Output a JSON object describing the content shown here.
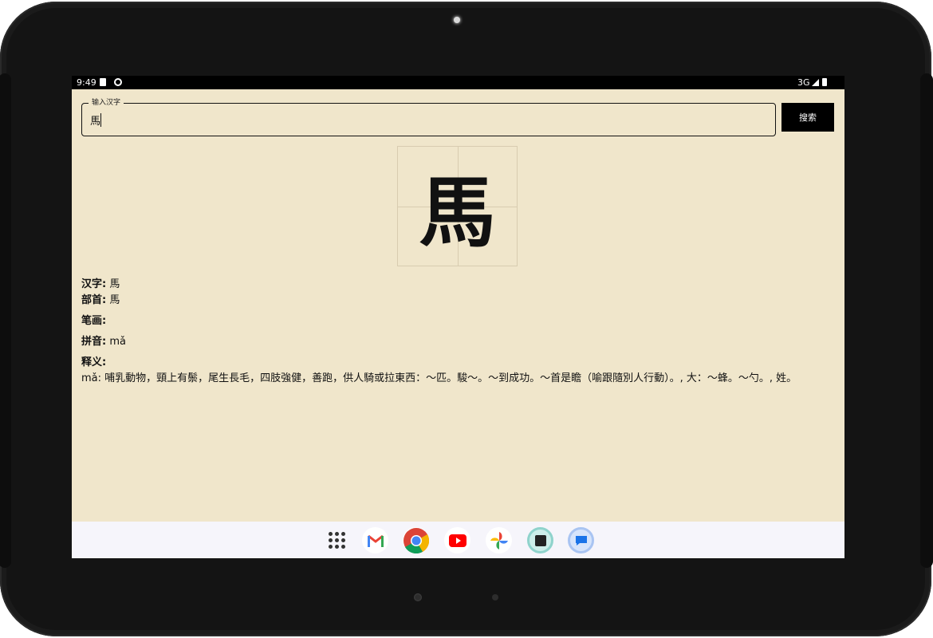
{
  "status_bar": {
    "time": "9:49",
    "network": "3G"
  },
  "search": {
    "label": "输入汉字",
    "value": "馬",
    "button": "搜索"
  },
  "character": {
    "glyph": "馬"
  },
  "info": {
    "hanzi_label": "汉字:",
    "hanzi_value": " 馬",
    "radical_label": "部首:",
    "radical_value": " 馬",
    "strokes_label": "笔画:",
    "strokes_value": "",
    "pinyin_label": "拼音:",
    "pinyin_value": " mǎ",
    "definition_label": "释义:",
    "definition_text": "mǎ: 哺乳動物，頸上有鬃，尾生長毛，四肢強健，善跑，供人騎或拉東西：～匹。駿～。～到成功。～首是瞻（喻跟隨別人行動）。, 大：～蜂。～勺。, 姓。"
  },
  "dock": {
    "apps": [
      "apps-grid-icon",
      "gmail-icon",
      "chrome-icon",
      "youtube-icon",
      "photos-icon",
      "camera-app-icon",
      "messages-icon"
    ]
  }
}
